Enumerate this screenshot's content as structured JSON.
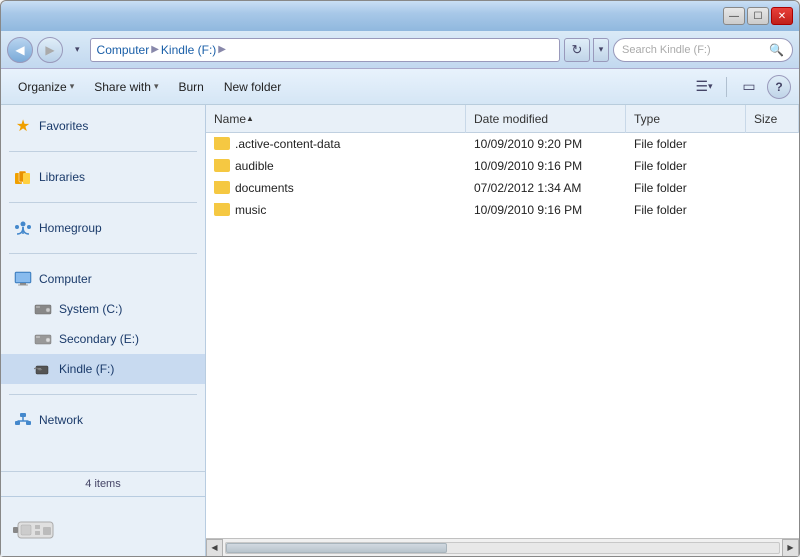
{
  "window": {
    "title": "Kindle (F:)",
    "titlebar_buttons": {
      "minimize": "—",
      "maximize": "☐",
      "close": "✕"
    }
  },
  "addressbar": {
    "back_btn": "◀",
    "forward_btn": "▶",
    "path_parts": [
      "Computer",
      "Kindle (F:)",
      ""
    ],
    "refresh_btn": "↻",
    "dropdown_btn": "▾",
    "search_placeholder": "Search Kindle (F:)",
    "search_icon": "🔍"
  },
  "toolbar": {
    "organize_label": "Organize",
    "share_with_label": "Share with",
    "burn_label": "Burn",
    "new_folder_label": "New folder",
    "view_icon": "≡",
    "preview_icon": "▭",
    "help_icon": "?"
  },
  "sidebar": {
    "favorites_label": "Favorites",
    "libraries_label": "Libraries",
    "homegroup_label": "Homegroup",
    "computer_label": "Computer",
    "system_c_label": "System (C:)",
    "secondary_e_label": "Secondary (E:)",
    "kindle_f_label": "Kindle (F:)",
    "network_label": "Network",
    "items_count": "4 items"
  },
  "file_list": {
    "columns": {
      "name": "Name",
      "date_modified": "Date modified",
      "type": "Type",
      "size": "Size"
    },
    "files": [
      {
        "name": ".active-content-data",
        "date_modified": "10/09/2010 9:20 PM",
        "type": "File folder",
        "size": ""
      },
      {
        "name": "audible",
        "date_modified": "10/09/2010 9:16 PM",
        "type": "File folder",
        "size": ""
      },
      {
        "name": "documents",
        "date_modified": "07/02/2012 1:34 AM",
        "type": "File folder",
        "size": ""
      },
      {
        "name": "music",
        "date_modified": "10/09/2010 9:16 PM",
        "type": "File folder",
        "size": ""
      }
    ]
  }
}
